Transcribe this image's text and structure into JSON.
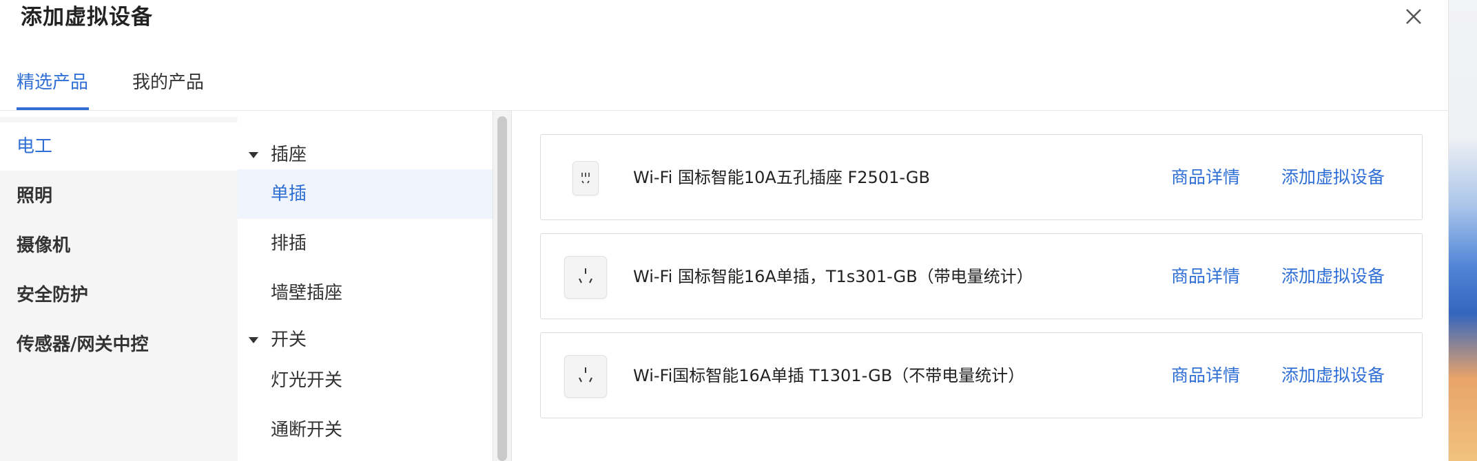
{
  "dialog": {
    "title": "添加虚拟设备"
  },
  "tabs": [
    {
      "label": "精选产品",
      "active": true
    },
    {
      "label": "我的产品",
      "active": false
    }
  ],
  "categories": [
    {
      "label": "电工",
      "active": true
    },
    {
      "label": "照明",
      "active": false
    },
    {
      "label": "摄像机",
      "active": false
    },
    {
      "label": "安全防护",
      "active": false
    },
    {
      "label": "传感器/网关中控",
      "active": false
    }
  ],
  "subcategories": {
    "groups": [
      {
        "label": "插座",
        "items": [
          "单插",
          "排插",
          "墙壁插座"
        ]
      },
      {
        "label": "开关",
        "items": [
          "灯光开关",
          "通断开关"
        ]
      }
    ],
    "selected": "单插"
  },
  "products": [
    {
      "name": "Wi-Fi 国标智能10A五孔插座 F2501-GB",
      "detail_label": "商品详情",
      "add_label": "添加虚拟设备",
      "icon": "five-hole-socket-icon"
    },
    {
      "name": "Wi-Fi 国标智能16A单插，T1s301-GB（带电量统计）",
      "detail_label": "商品详情",
      "add_label": "添加虚拟设备",
      "icon": "single-socket-icon"
    },
    {
      "name": "Wi-Fi国标智能16A单插 T1301-GB（不带电量统计）",
      "detail_label": "商品详情",
      "add_label": "添加虚拟设备",
      "icon": "single-socket-icon"
    }
  ],
  "colors": {
    "accent": "#2f6fd6",
    "sidebar_bg": "#f5f5f6",
    "selected_bg": "#f0f4fc"
  }
}
